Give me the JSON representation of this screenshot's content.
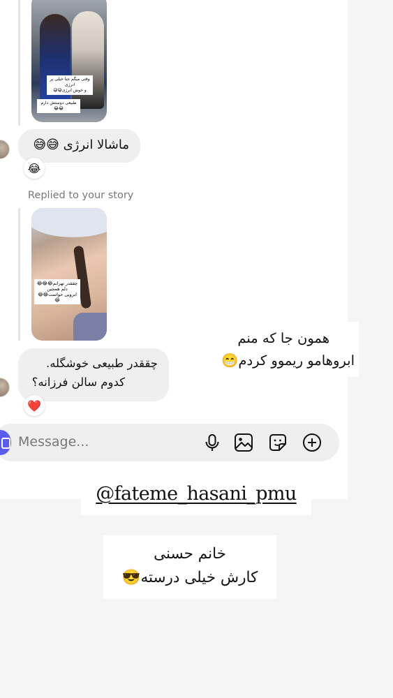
{
  "conversation": {
    "story_1_caption_line1": "وقتی میگم جنا خیلی پر انرژی",
    "story_1_caption_line2": "و خوش انرژی😅😅",
    "story_1_caption_line3": "طبیعی دوستش دارم😂😂",
    "message_1_text": "ماشالا انرژی 😅😅",
    "message_1_reaction": "😂",
    "replied_label": "Replied to your story",
    "story_2_caption_line1": "چققدر تهرانم😂😂😂",
    "story_2_caption_line2": "دلم همچین",
    "story_2_caption_line3": "ابرویی خواست😂😂😂",
    "message_2_line1": "چققدر طبیعی خوشگله.",
    "message_2_line2": "کدوم سالن فرزانه؟",
    "message_2_reaction": "❤️"
  },
  "composer": {
    "placeholder": "Message...",
    "icons": [
      "microphone-icon",
      "image-icon",
      "sticker-icon",
      "add-icon"
    ]
  },
  "overlay": {
    "note_line1": "همون جا که منم",
    "note_line2": "ابروهامو ریموو کردم😁",
    "mention": "@fateme_hasani_pmu",
    "caption_line1": "خانم حسنی",
    "caption_line2": "کارش خیلی درسته😎"
  },
  "colors": {
    "bubble": "#efefef",
    "accent": "#5b5bf0",
    "muted_text": "#777777"
  }
}
